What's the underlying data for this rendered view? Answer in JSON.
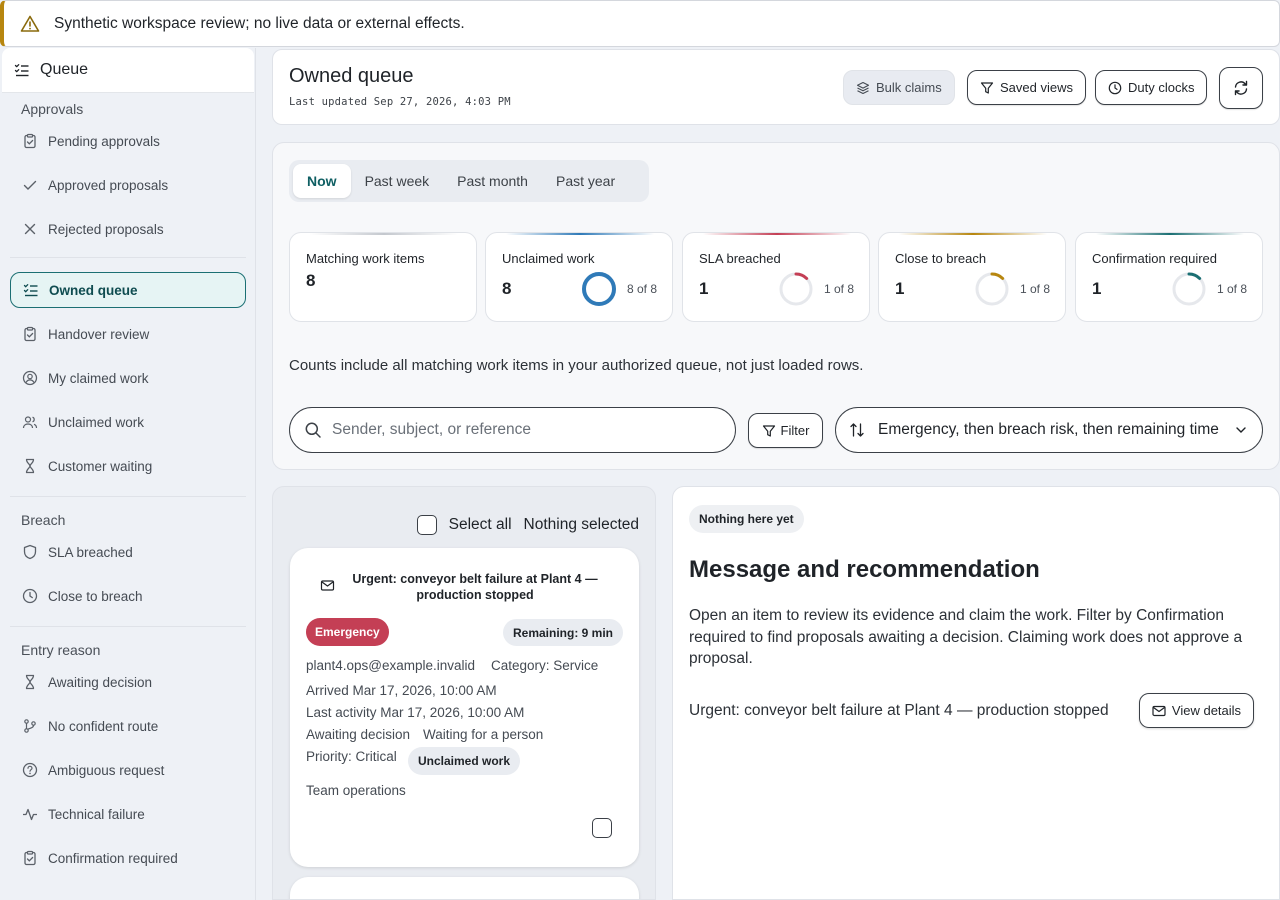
{
  "banner": {
    "text": "Synthetic workspace review; no live data or external effects.",
    "icon": "warning-icon"
  },
  "sidebar": {
    "header": "Queue",
    "groups": [
      {
        "label": "Approvals",
        "items": [
          "Pending approvals",
          "Approved proposals",
          "Rejected proposals"
        ]
      },
      {
        "label": "",
        "items": [
          "Owned queue",
          "Handover review",
          "My claimed work",
          "Unclaimed work",
          "Customer waiting"
        ]
      },
      {
        "label": "Breach",
        "items": [
          "SLA breached",
          "Close to breach"
        ]
      },
      {
        "label": "Entry reason",
        "items": [
          "Awaiting decision",
          "No confident route",
          "Ambiguous request",
          "Technical failure",
          "Confirmation required"
        ]
      }
    ],
    "active_item": "Owned queue"
  },
  "header": {
    "title": "Owned queue",
    "updated": "Last updated Sep 27, 2026, 4:03 PM",
    "buttons": {
      "bulk": "Bulk claims",
      "saved": "Saved views",
      "duty": "Duty clocks"
    }
  },
  "tabs": [
    "Now",
    "Past week",
    "Past month",
    "Past year"
  ],
  "active_tab": "Now",
  "stats": [
    {
      "label": "Matching work items",
      "value": "8"
    },
    {
      "label": "Unclaimed work",
      "value": "8",
      "of": "8 of 8",
      "fraction": 1.0,
      "color": "#2f7ab8"
    },
    {
      "label": "SLA breached",
      "value": "1",
      "of": "1 of 8",
      "fraction": 0.125,
      "color": "#c43f55"
    },
    {
      "label": "Close to breach",
      "value": "1",
      "of": "1 of 8",
      "fraction": 0.125,
      "color": "#b7860f"
    },
    {
      "label": "Confirmation required",
      "value": "1",
      "of": "1 of 8",
      "fraction": 0.125,
      "color": "#1b6f73"
    }
  ],
  "counts_note": "Counts include all matching work items in your authorized queue, not just loaded rows.",
  "search": {
    "placeholder": "Sender, subject, or reference",
    "value": ""
  },
  "filter_label": "Filter",
  "sort": {
    "selected": "Emergency, then breach risk, then remaining time"
  },
  "list": {
    "select_all": "Select all",
    "selection_status": "Nothing selected",
    "items": [
      {
        "subject": "Urgent: conveyor belt failure at Plant 4 — production stopped",
        "badge": "Emergency",
        "remaining": "Remaining: 9 min",
        "sender": "plant4.ops@example.invalid",
        "category": "Category: Service",
        "arrived": "Arrived Mar 17, 2026, 10:00 AM",
        "last_activity": "Last activity Mar 17, 2026, 10:00 AM",
        "reason": "Awaiting decision",
        "waiting": "Waiting for a person",
        "priority": "Priority: Critical",
        "claim_status": "Unclaimed work",
        "team": "Team operations"
      }
    ]
  },
  "detail": {
    "status_chip": "Nothing here yet",
    "title": "Message and recommendation",
    "body": "Open an item to review its evidence and claim the work. Filter by Confirmation required to find proposals awaiting a decision. Claiming work does not approve a proposal.",
    "item_subject": "Urgent: conveyor belt failure at Plant 4 — production stopped",
    "view_details": "View details"
  }
}
